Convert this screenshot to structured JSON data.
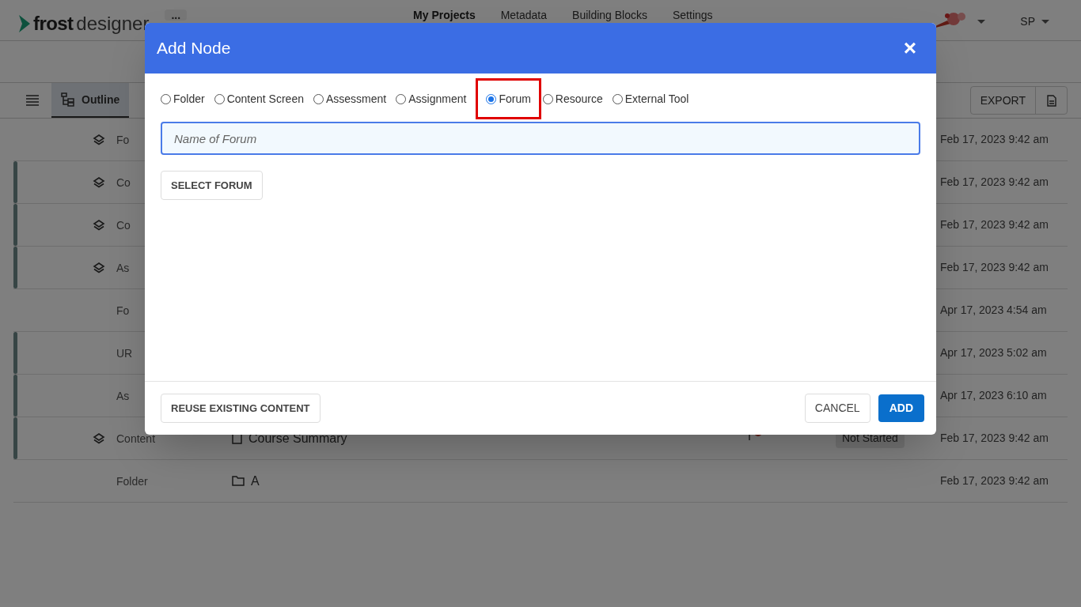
{
  "header": {
    "logo_text": "frost",
    "logo_suffix": "designer",
    "more": "...",
    "nav": [
      {
        "label": "My Projects",
        "selected": true
      },
      {
        "label": "Metadata",
        "selected": false
      },
      {
        "label": "Building Blocks",
        "selected": false
      },
      {
        "label": "Settings",
        "selected": false
      }
    ],
    "user": "SP"
  },
  "toolbar": {
    "tabs": [
      {
        "label": "Outline",
        "selected": true
      }
    ],
    "export": "EXPORT"
  },
  "rows": [
    {
      "accent": false,
      "layers": true,
      "type": "Fo",
      "date": "Feb 17, 2023 9:42 am"
    },
    {
      "accent": true,
      "layers": true,
      "type": "Co",
      "date": "Feb 17, 2023 9:42 am"
    },
    {
      "accent": true,
      "layers": true,
      "type": "Co",
      "date": "Feb 17, 2023 9:42 am"
    },
    {
      "accent": true,
      "layers": true,
      "type": "As",
      "date": "Feb 17, 2023 9:42 am"
    },
    {
      "accent": false,
      "layers": false,
      "type": "Fo",
      "date": "Apr 17, 2023 4:54 am"
    },
    {
      "accent": true,
      "layers": false,
      "type": "UR",
      "date": "Apr 17, 2023 5:02 am"
    },
    {
      "accent": true,
      "layers": false,
      "type": "As",
      "date": "Apr 17, 2023 6:10 am"
    },
    {
      "accent": true,
      "layers": true,
      "type": "Content",
      "kind": "page",
      "title": "Course Summary",
      "flag": true,
      "status": "Not Started",
      "date": "Feb 17, 2023 9:42 am"
    },
    {
      "accent": false,
      "layers": false,
      "type": "Folder",
      "kind": "folder",
      "title": "A",
      "flag": false,
      "date": "Feb 17, 2023 9:42 am"
    }
  ],
  "dialog": {
    "title": "Add Node",
    "close": "×",
    "options": [
      {
        "label": "Folder",
        "selected": false,
        "highlighted": false
      },
      {
        "label": "Content Screen",
        "selected": false,
        "highlighted": false
      },
      {
        "label": "Assessment",
        "selected": false,
        "highlighted": false
      },
      {
        "label": "Assignment",
        "selected": false,
        "highlighted": false
      },
      {
        "label": "Forum",
        "selected": true,
        "highlighted": true
      },
      {
        "label": "Resource",
        "selected": false,
        "highlighted": false
      },
      {
        "label": "External Tool",
        "selected": false,
        "highlighted": false
      }
    ],
    "name_field": {
      "placeholder": "Name of Forum"
    },
    "select_button": "SELECT FORUM",
    "reuse_button": "REUSE EXISTING CONTENT",
    "cancel_button": "CANCEL",
    "add_button": "ADD"
  }
}
